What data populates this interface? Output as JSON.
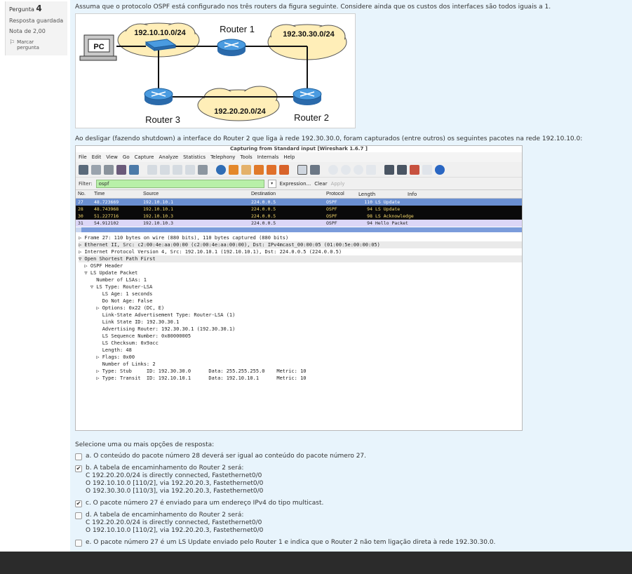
{
  "question": {
    "label": "Pergunta",
    "number": "4",
    "state": "Resposta guardada",
    "grade": "Nota de 2,00",
    "flag_label_1": "Marcar",
    "flag_label_2": "pergunta"
  },
  "text": {
    "intro": "Assuma que o protocolo OSPF está configurado nos três routers da figura seguinte. Considere ainda que os custos dos interfaces são todos iguais a 1.",
    "capture_intro": "Ao desligar (fazendo shutdown) a interface do Router 2 que liga à rede 192.30.30.0, foram capturados (entre outros) os seguintes pacotes na rede 192.10.10.0:"
  },
  "diagram": {
    "pc": "PC",
    "net1": "192.10.10.0/24",
    "net2": "192.30.30.0/24",
    "net3": "192.20.20.0/24",
    "router1": "Router 1",
    "router2": "Router 2",
    "router3": "Router 3"
  },
  "wireshark": {
    "title": "Capturing from Standard input   [Wireshark 1.6.7 ]",
    "menu": [
      "File",
      "Edit",
      "View",
      "Go",
      "Capture",
      "Analyze",
      "Statistics",
      "Telephony",
      "Tools",
      "Internals",
      "Help"
    ],
    "filter_label": "Filter:",
    "filter_value": "ospf",
    "expression": "Expression...",
    "clear": "Clear",
    "apply": "Apply",
    "columns": [
      "No.",
      "Time",
      "Source",
      "Destination",
      "Protocol",
      "Length",
      "Info"
    ],
    "packets": [
      {
        "no": "27",
        "time": "48.723669",
        "src": "192.10.10.1",
        "dst": "224.0.0.5",
        "proto": "OSPF",
        "len": "110",
        "info": "LS Update"
      },
      {
        "no": "28",
        "time": "48.743968",
        "src": "192.10.10.1",
        "dst": "224.0.0.5",
        "proto": "OSPF",
        "len": "94",
        "info": "LS Update"
      },
      {
        "no": "30",
        "time": "51.227716",
        "src": "192.10.10.3",
        "dst": "224.0.0.5",
        "proto": "OSPF",
        "len": "98",
        "info": "LS Acknowledge"
      },
      {
        "no": "31",
        "time": "54.912102",
        "src": "192.10.10.3",
        "dst": "224.0.0.5",
        "proto": "OSPF",
        "len": "94",
        "info": "Hello Packet"
      }
    ],
    "details": [
      "▷ Frame 27: 110 bytes on wire (880 bits), 110 bytes captured (880 bits)",
      "▷ Ethernet II, Src: c2:00:4e:aa:00:00 (c2:00:4e:aa:00:00), Dst: IPv4mcast_00:00:05 (01:00:5e:00:00:05)",
      "▷ Internet Protocol Version 4, Src: 192.10.10.1 (192.10.10.1), Dst: 224.0.0.5 (224.0.0.5)",
      "▽ Open Shortest Path First",
      "  ▷ OSPF Header",
      "  ▽ LS Update Packet",
      "      Number of LSAs: 1",
      "    ▽ LS Type: Router-LSA",
      "        LS Age: 1 seconds",
      "        Do Not Age: False",
      "      ▷ Options: 0x22 (DC, E)",
      "        Link-State Advertisement Type: Router-LSA (1)",
      "        Link State ID: 192.30.30.1",
      "        Advertising Router: 192.30.30.1 (192.30.30.1)",
      "        LS Sequence Number: 0x80000005",
      "        LS Checksum: 0x9acc",
      "        Length: 48",
      "      ▷ Flags: 0x00",
      "        Number of Links: 2",
      "      ▷ Type: Stub     ID: 192.30.30.0      Data: 255.255.255.0    Metric: 10",
      "      ▷ Type: Transit  ID: 192.10.10.1      Data: 192.10.10.1      Metric: 10"
    ]
  },
  "answers": {
    "prompt": "Selecione uma ou mais opções de resposta:",
    "a": {
      "text": "a. O conteúdo do pacote número 28 deverá ser igual ao conteúdo do pacote número 27.",
      "checked": false
    },
    "b": {
      "lines": [
        "b. A tabela de encaminhamento do Router 2 será:",
        "C 192.20.20.0/24 is directly connected, Fastethernet0/0",
        "O 192.10.10.0 [110/2], via 192.20.20.3, Fastethernet0/0",
        "O 192.30.30.0 [110/3], via 192.20.20.3, Fastethernet0/0"
      ],
      "checked": true
    },
    "c": {
      "text": "c. O pacote número 27 é enviado para um endereço IPv4 do tipo multicast.",
      "checked": true
    },
    "d": {
      "lines": [
        "d. A tabela de encaminhamento do Router 2 será:",
        "C 192.20.20.0/24 is directly connected, Fastethernet0/0",
        "O 192.10.10.0 [110/2], via 192.20.20.3, Fastethernet0/0"
      ],
      "checked": false
    },
    "e": {
      "text": "e. O pacote número 27 é um LS Update enviado pelo Router 1 e indica que o Router 2 não tem ligação direta à rede 192.30.30.0.",
      "checked": false
    }
  }
}
